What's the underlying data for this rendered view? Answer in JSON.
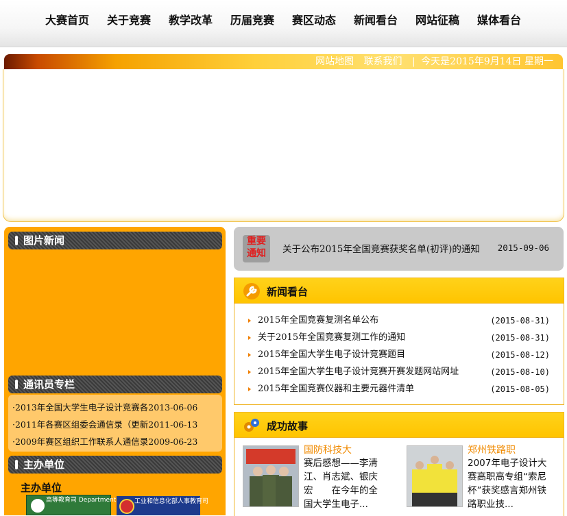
{
  "nav": [
    "大赛首页",
    "关于竞赛",
    "教学改革",
    "历届竞赛",
    "赛区动态",
    "新闻看台",
    "网站征稿",
    "媒体看台"
  ],
  "strip": {
    "sitemap": "网站地图",
    "contact": "联系我们",
    "separator": "|",
    "today": "今天是2015年9月14日 星期一"
  },
  "left": {
    "pic_news_title": "图片新闻",
    "corr_title": "通讯员专栏",
    "corr_items": [
      {
        "text": "·2013年全国大学生电子设计竞赛各",
        "date": "2013-06-06"
      },
      {
        "text": "·2011年各赛区组委会通信录（更新",
        "date": "2011-06-13"
      },
      {
        "text": "·2009年赛区组织工作联系人通信录",
        "date": "2009-06-23"
      }
    ],
    "host_bar_title": "主办单位",
    "host_label": "主办单位",
    "logo1": "高等教育司 Department of Higher Education",
    "logo2": "工业和信息化部人事教育司"
  },
  "notice": {
    "tag_top": "重要",
    "tag_bottom": "通知",
    "text": "关于公布2015年全国竞赛获奖名单(初评)的通知",
    "date": "2015-09-06"
  },
  "news": {
    "title": "新闻看台",
    "items": [
      {
        "text": "2015年全国竞赛复测名单公布",
        "date": "(2015-08-31)"
      },
      {
        "text": "关于2015年全国竞赛复测工作的通知",
        "date": "(2015-08-31)"
      },
      {
        "text": "2015年全国大学生电子设计竞赛题目",
        "date": "(2015-08-12)"
      },
      {
        "text": "2015年全国大学生电子设计竞赛开赛发题网站网址",
        "date": "(2015-08-10)"
      },
      {
        "text": "2015年全国竞赛仪器和主要元器件清单",
        "date": "(2015-08-05)"
      }
    ]
  },
  "stories": {
    "title": "成功故事",
    "items": [
      {
        "title": "国防科技大",
        "body": "赛后感想——李清江、肖志斌、银庆宏　　在今年的全国大学生电子..."
      },
      {
        "title": "郑州铁路职",
        "body": "2007年电子设计大赛高职高专组“索尼杯”获奖感言郑州铁路职业技..."
      }
    ]
  },
  "colors": {
    "accent": "#ffa500",
    "header": "#ffc400",
    "notice_bg": "#c9c9c9"
  }
}
